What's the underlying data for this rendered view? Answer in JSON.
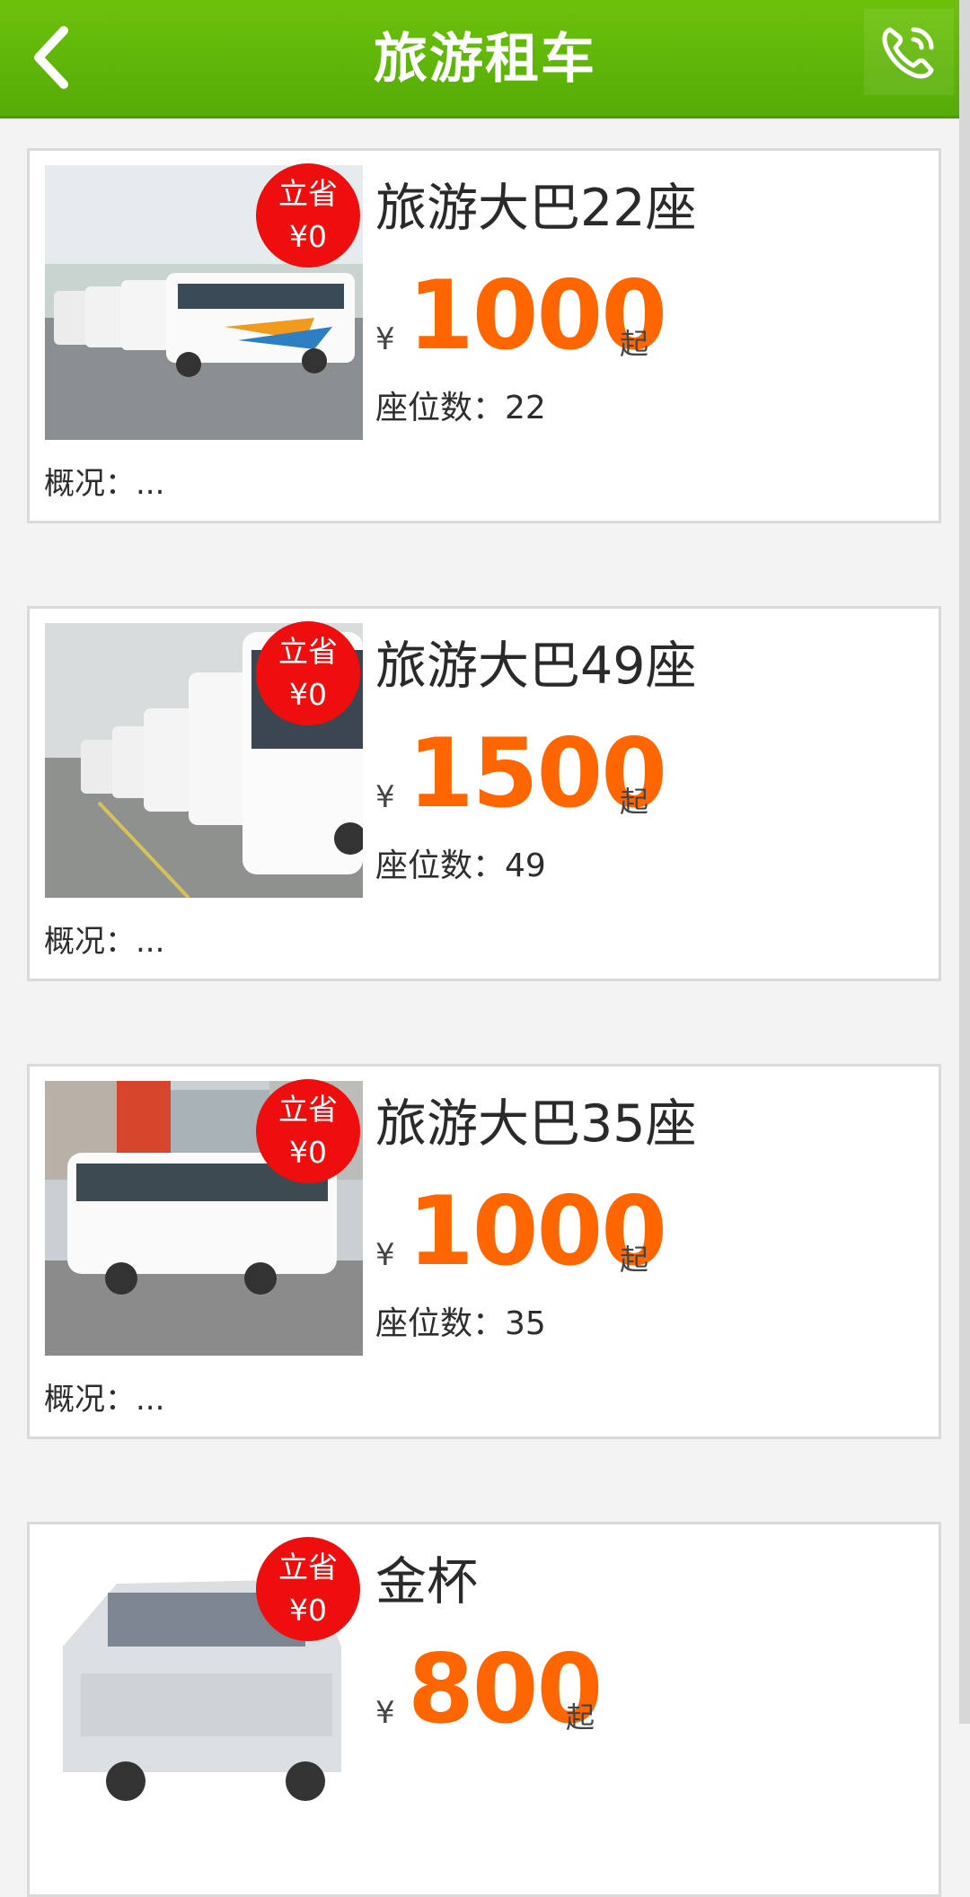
{
  "header": {
    "title": "旅游租车",
    "back_icon": "chevron-left-icon",
    "phone_icon": "phone-call-icon",
    "accent": "#62b80a"
  },
  "vehicles": [
    {
      "name": "旅游大巴22座",
      "badge_line1": "立省",
      "badge_line2": "¥0",
      "currency": "¥",
      "price": "1000",
      "price_suffix": "起",
      "seats": "座位数：22",
      "summary": "概况：..."
    },
    {
      "name": "旅游大巴49座",
      "badge_line1": "立省",
      "badge_line2": "¥0",
      "currency": "¥",
      "price": "1500",
      "price_suffix": "起",
      "seats": "座位数：49",
      "summary": "概况：..."
    },
    {
      "name": "旅游大巴35座",
      "badge_line1": "立省",
      "badge_line2": "¥0",
      "currency": "¥",
      "price": "1000",
      "price_suffix": "起",
      "seats": "座位数：35",
      "summary": "概况：..."
    },
    {
      "name": "金杯",
      "badge_line1": "立省",
      "badge_line2": "¥0",
      "currency": "¥",
      "price": "800",
      "price_suffix": "起",
      "seats": "",
      "summary": ""
    }
  ],
  "colors": {
    "price": "#ff6600",
    "badge": "#ee0e0e"
  }
}
